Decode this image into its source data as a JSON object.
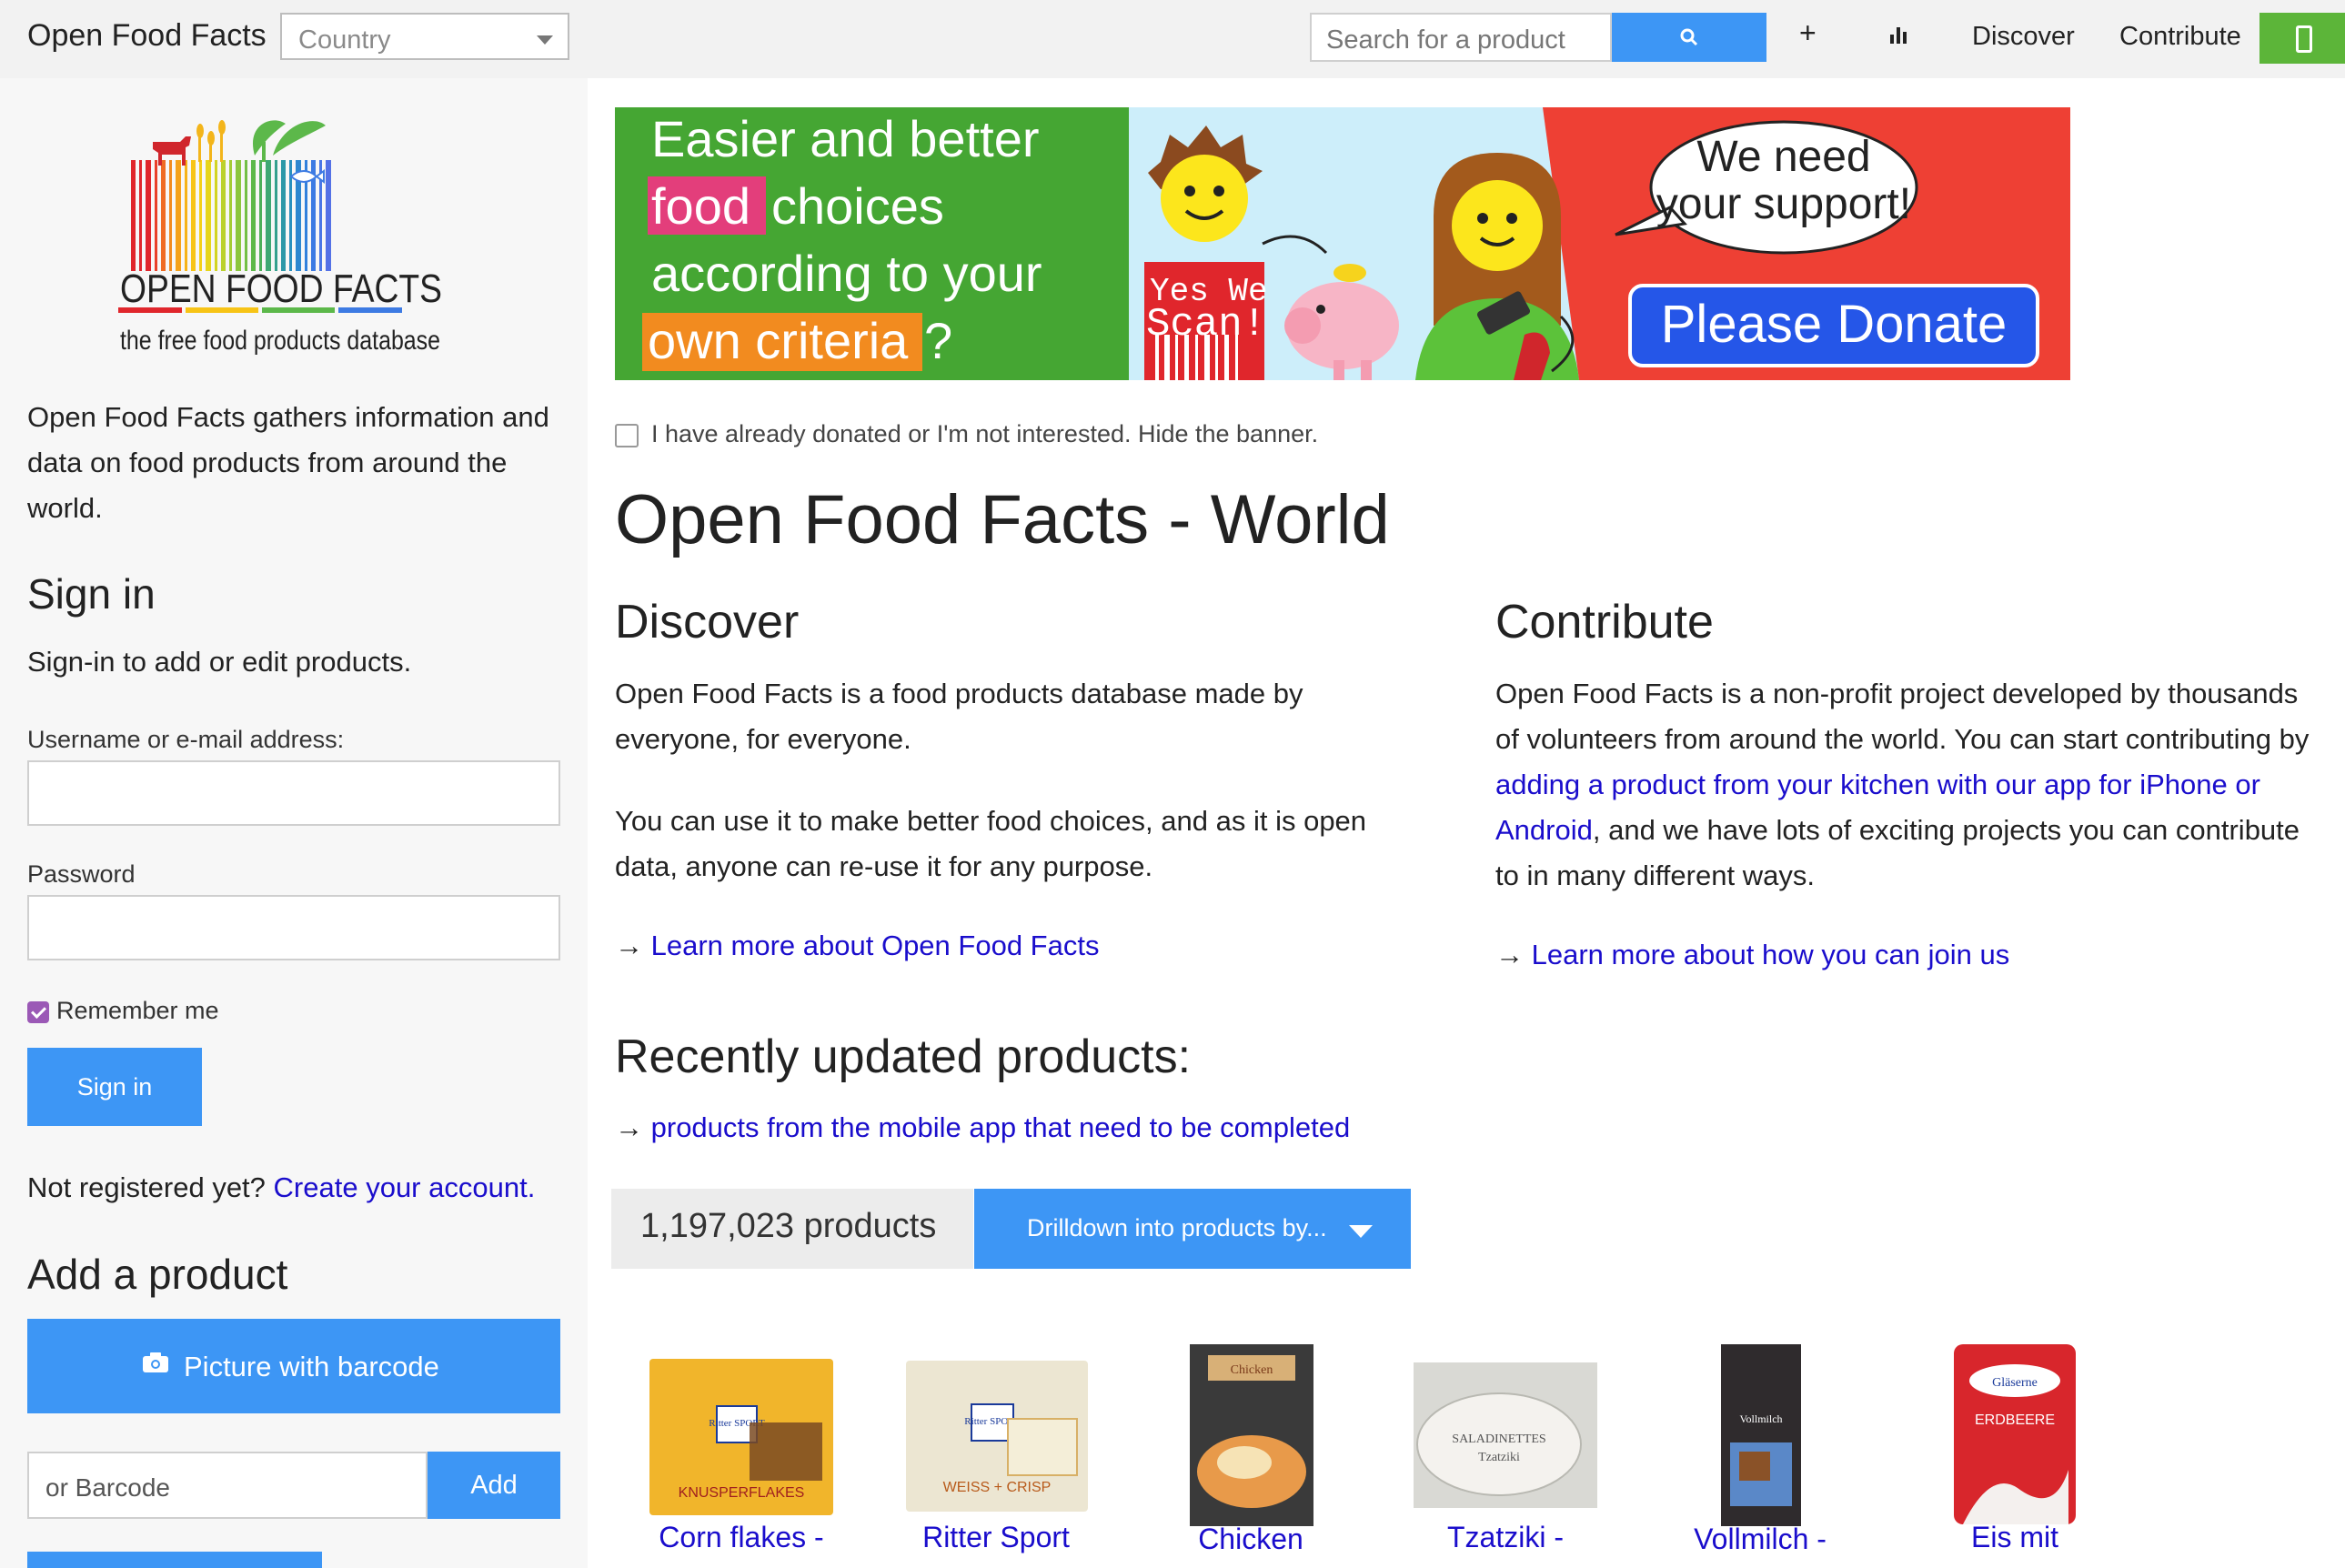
{
  "topbar": {
    "brand": "Open Food Facts",
    "country_placeholder": "Country",
    "search_placeholder": "Search for a product",
    "add_symbol": "+",
    "discover": "Discover",
    "contribute": "Contribute"
  },
  "sidebar": {
    "intro": "Open Food Facts gathers information and data on food products from around the world.",
    "logo_title": "OPEN FOOD FACTS",
    "logo_subtitle": "the free food products database",
    "signin_title": "Sign in",
    "signin_subtitle": "Sign-in to add or edit products.",
    "username_label": "Username or e-mail address:",
    "password_label": "Password",
    "remember_me": "Remember me",
    "signin_button": "Sign in",
    "not_registered": "Not registered yet?",
    "create_account": "Create your account.",
    "add_product_title": "Add a product",
    "picture_button": "Picture with barcode",
    "barcode_placeholder": "or Barcode",
    "add_button": "Add"
  },
  "banner": {
    "line1": "Easier and better",
    "line2_highlight": "food",
    "line2_rest": "choices",
    "line3": "according to your",
    "line4_highlight": "own criteria",
    "line4_rest": "?",
    "sign_line1": "Yes We",
    "sign_line2": "Scan!",
    "bubble_line1": "We need",
    "bubble_line2": "your support!",
    "donate_button": "Please Donate",
    "hide_text": "I have already donated or I'm not interested. Hide the banner."
  },
  "main": {
    "title": "Open Food Facts - World",
    "discover_title": "Discover",
    "discover_p1": "Open Food Facts is a food products database made by everyone, for everyone.",
    "discover_p2": "You can use it to make better food choices, and as it is open data, anyone can re-use it for any purpose.",
    "arrow": "→",
    "discover_link": "Learn more about Open Food Facts",
    "contribute_title": "Contribute",
    "contribute_p_start": "Open Food Facts is a non-profit project developed by thousands of volunteers from around the world. You can start contributing by",
    "contribute_p_link": "adding a product from your kitchen with our app for iPhone or Android",
    "contribute_p_end": ", and we have lots of exciting projects you can contribute to in many different ways.",
    "contribute_link": "Learn more about how you can join us",
    "recent_title": "Recently updated products:",
    "recent_link": "products from the mobile app that need to be completed",
    "product_count": "1,197,023 products",
    "drilldown": "Drilldown into products by...",
    "products": [
      {
        "name": "Corn flakes -",
        "brand_text": "Ritter SPORT",
        "flavor_text": "KNUSPERFLAKES",
        "color": "#f1b52b"
      },
      {
        "name": "Ritter Sport",
        "brand_text": "Ritter SPORT",
        "flavor_text": "WEISS + CRISP",
        "color": "#ece6d2"
      },
      {
        "name": "Chicken",
        "brand_text": "Chicken",
        "flavor_text": "",
        "color": "#3a3a3a"
      },
      {
        "name": "Tzatziki -",
        "brand_text": "SALADINETTES",
        "flavor_text": "Tzatziki",
        "color": "#d9d9d4"
      },
      {
        "name": "Vollmilch -",
        "brand_text": "Vollmilch",
        "flavor_text": "",
        "color": "#2f2b2d"
      },
      {
        "name": "Eis mit",
        "brand_text": "Gläserne",
        "flavor_text": "ERDBEERE",
        "color": "#d8262c"
      }
    ]
  }
}
